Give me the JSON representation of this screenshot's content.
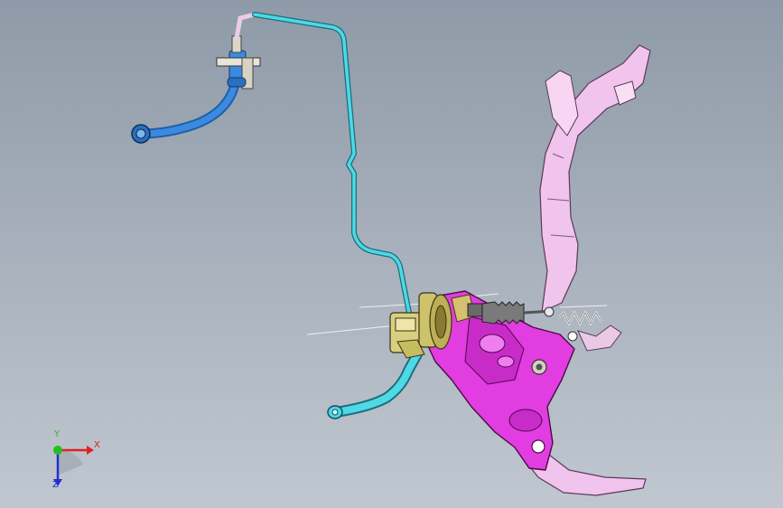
{
  "viewport": {
    "background_top": "#8f9aa8",
    "background_bottom": "#c0c7d0"
  },
  "parts": [
    {
      "name": "brake-fluid-hose",
      "color": "#3a8be0"
    },
    {
      "name": "clutch-hydraulic-line",
      "color": "#4fd8e6"
    },
    {
      "name": "clutch-master-cylinder",
      "color": "#d8cf80"
    },
    {
      "name": "pedal-bracket",
      "color": "#e23de0"
    },
    {
      "name": "clutch-pedal-arm",
      "color": "#f0c4ec"
    },
    {
      "name": "return-spring",
      "color": "#e8e8e8"
    }
  ],
  "triad": {
    "x_label": "X",
    "y_label": "Y",
    "z_label": "Z",
    "x_color": "#e02020",
    "y_color": "#20c020",
    "z_color": "#2030d0"
  }
}
